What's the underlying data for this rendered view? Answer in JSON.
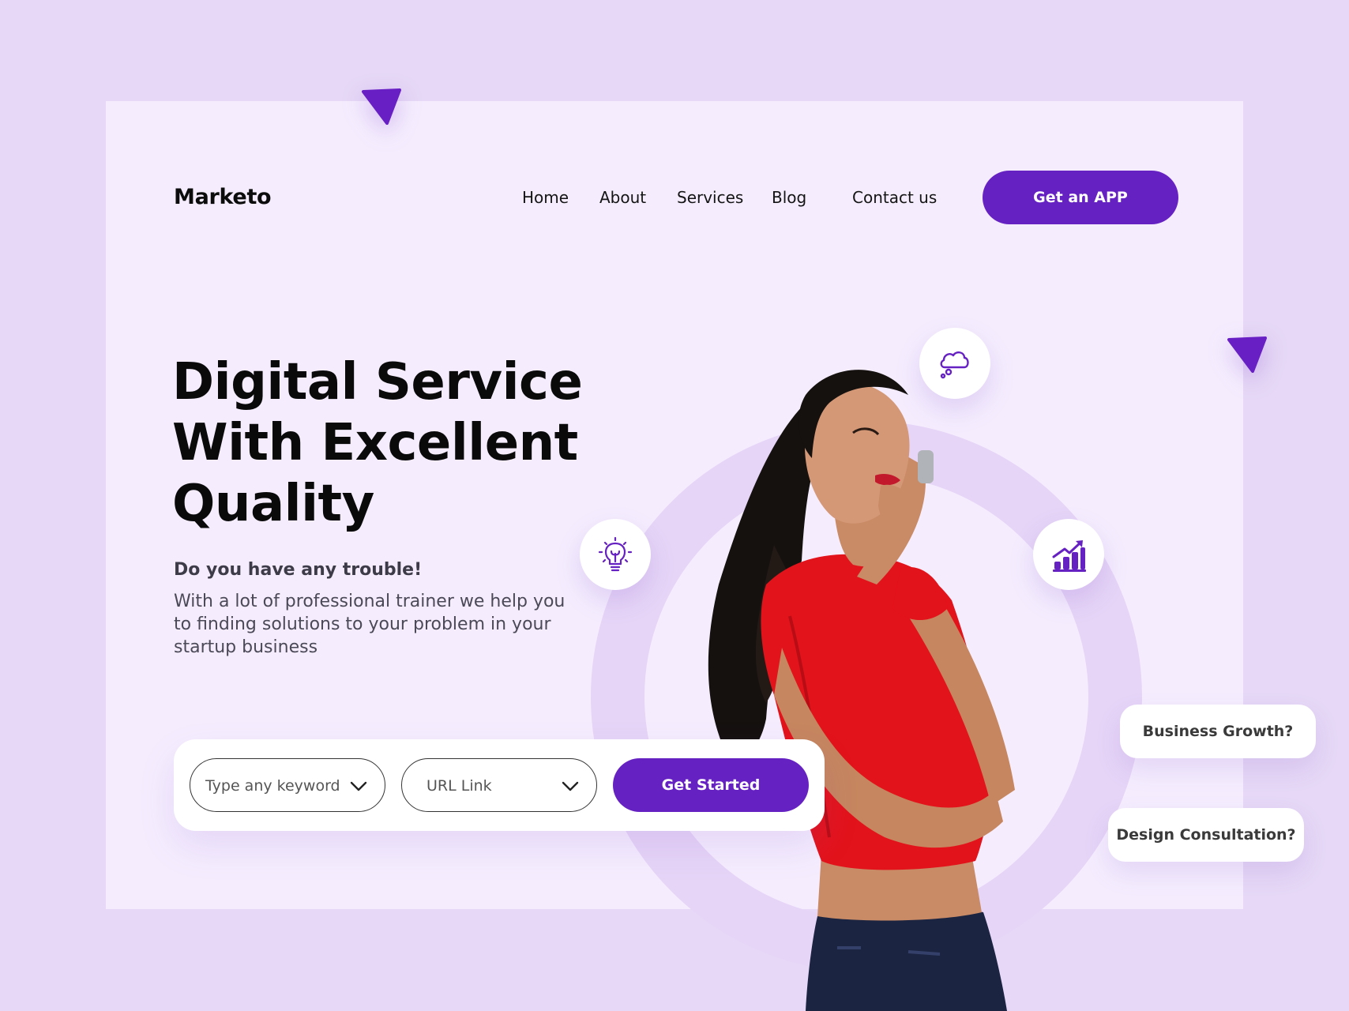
{
  "brand": {
    "logo": "Marketo",
    "accent": "#6621c2",
    "background": "#e6d8f6",
    "card": "#f5edfe"
  },
  "nav": {
    "items": [
      "Home",
      "About",
      "Services",
      "Blog",
      "Contact us"
    ],
    "cta_label": "Get an APP"
  },
  "hero": {
    "title_lines": [
      "Digital Service",
      "With Excellent",
      "Quality"
    ],
    "subtitle": "Do you have any trouble!",
    "description": "With a lot of professional trainer we help you to finding solutions to your problem in your startup business"
  },
  "search": {
    "keyword_placeholder": "Type any keyword",
    "url_placeholder": "URL Link",
    "submit_label": "Get Started"
  },
  "floating": {
    "icons": [
      "idea-cloud-icon",
      "lightbulb-icon",
      "growth-chart-icon"
    ],
    "tags": [
      "Business Growth?",
      "Design Consultation?"
    ]
  }
}
